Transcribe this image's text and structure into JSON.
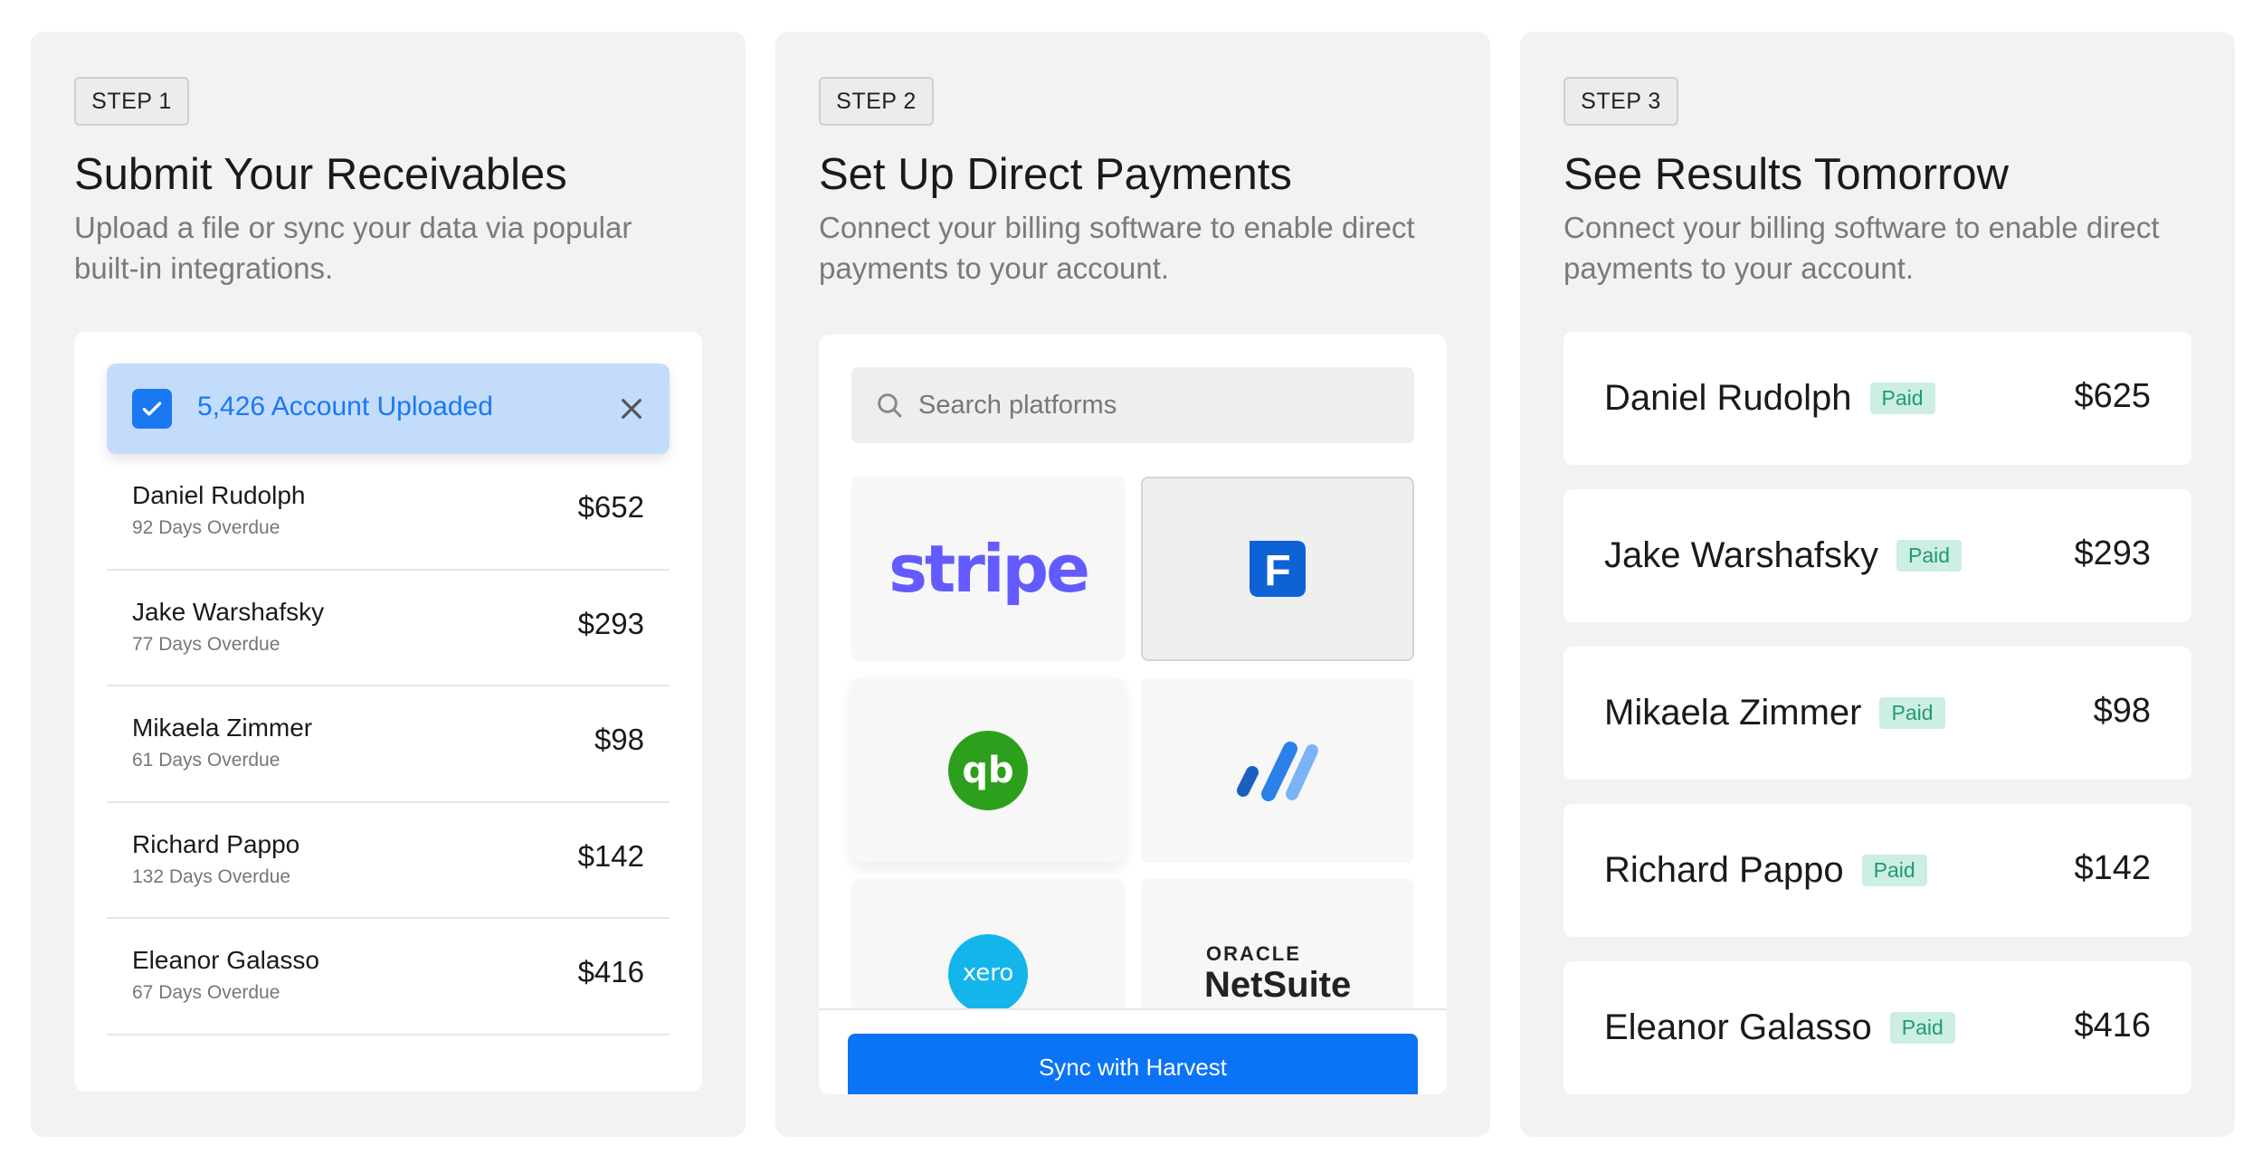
{
  "steps": [
    {
      "badge": "STEP 1",
      "title": "Submit Your Receivables",
      "description": "Upload a file or sync your data via popular built-in integrations."
    },
    {
      "badge": "STEP 2",
      "title": "Set Up Direct Payments",
      "description": "Connect your billing software to enable direct payments to your account."
    },
    {
      "badge": "STEP 3",
      "title": "See Results Tomorrow",
      "description": "Connect your billing software to enable direct payments to your account."
    }
  ],
  "upload": {
    "message": "5,426 Account Uploaded"
  },
  "overdue_accounts": [
    {
      "name": "Daniel Rudolph",
      "status": "92 Days Overdue",
      "amount": "$652"
    },
    {
      "name": "Jake Warshafsky",
      "status": "77 Days Overdue",
      "amount": "$293"
    },
    {
      "name": "Mikaela Zimmer",
      "status": "61 Days Overdue",
      "amount": "$98"
    },
    {
      "name": "Richard Pappo",
      "status": "132 Days Overdue",
      "amount": "$142"
    },
    {
      "name": "Eleanor Galasso",
      "status": "67 Days Overdue",
      "amount": "$416"
    }
  ],
  "platforms": {
    "search_placeholder": "Search platforms",
    "tiles": [
      {
        "name": "stripe-logo",
        "label": "stripe"
      },
      {
        "name": "freshbooks-logo",
        "label": "F",
        "selected": true
      },
      {
        "name": "quickbooks-logo",
        "label": "qb"
      },
      {
        "name": "wave-logo",
        "label": ""
      },
      {
        "name": "xero-logo",
        "label": "xero"
      },
      {
        "name": "oracle-netsuite-logo",
        "label_top": "ORACLE",
        "label_bottom": "NetSuite"
      }
    ],
    "sync_button": "Sync with Harvest"
  },
  "paid_accounts": [
    {
      "name": "Daniel Rudolph",
      "badge": "Paid",
      "amount": "$625"
    },
    {
      "name": "Jake Warshafsky",
      "badge": "Paid",
      "amount": "$293"
    },
    {
      "name": "Mikaela Zimmer",
      "badge": "Paid",
      "amount": "$98"
    },
    {
      "name": "Richard Pappo",
      "badge": "Paid",
      "amount": "$142"
    },
    {
      "name": "Eleanor Galasso",
      "badge": "Paid",
      "amount": "$416"
    }
  ],
  "colors": {
    "accent_blue": "#0b73f5",
    "upload_banner": "#c3dcfb",
    "paid_badge_bg": "#cdeee2",
    "paid_badge_text": "#1e9c6c",
    "stripe_purple": "#635bff",
    "quickbooks_green": "#2ca01c",
    "xero_blue": "#13b5ea"
  }
}
